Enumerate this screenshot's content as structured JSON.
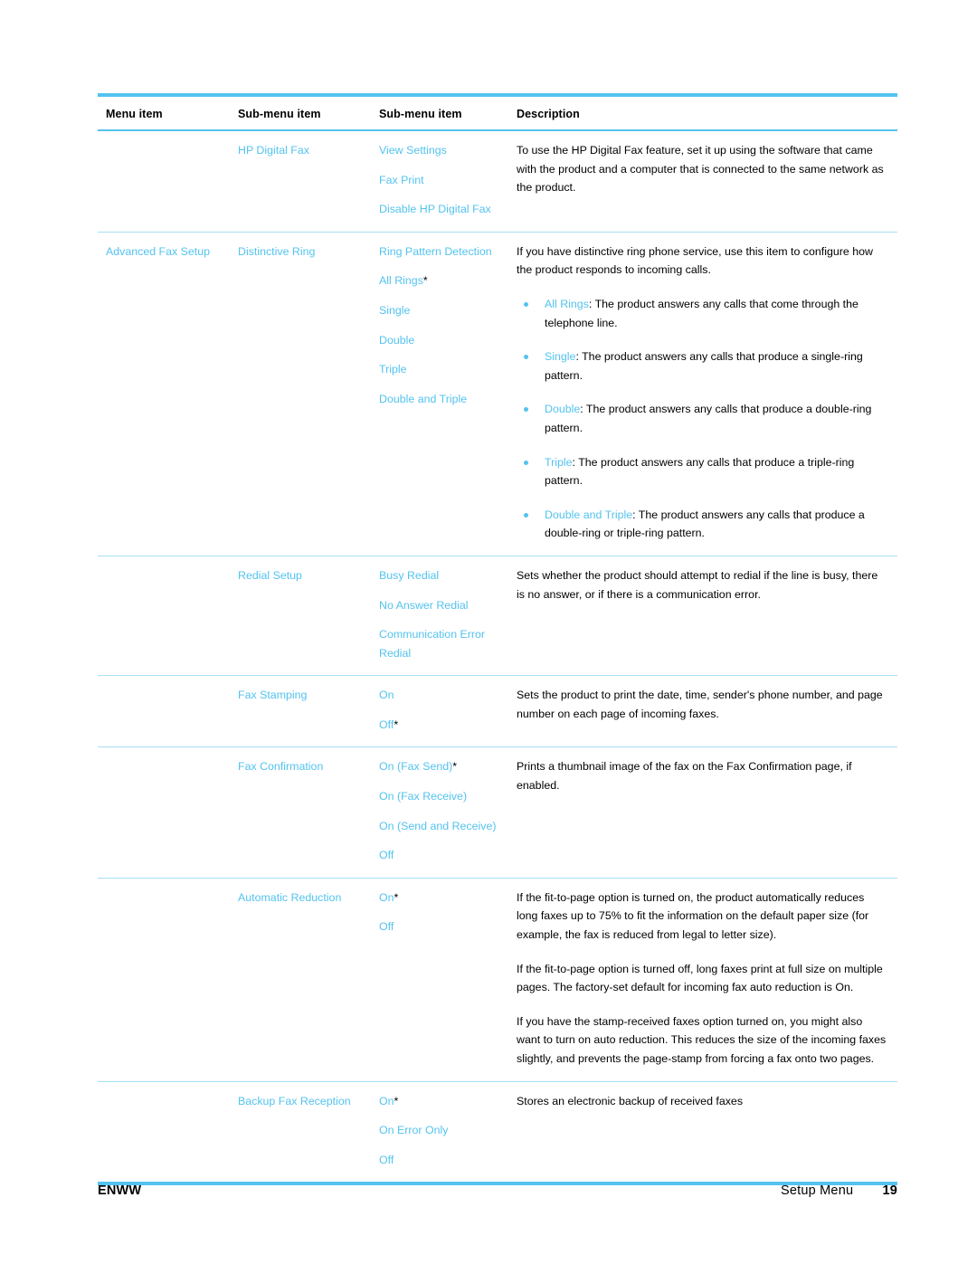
{
  "document": {
    "table": {
      "headers": [
        "Menu item",
        "Sub-menu item",
        "Sub-menu item",
        "Description"
      ],
      "rows": [
        {
          "menu_item": "",
          "sub_menu_1": "HP Digital Fax",
          "sub_menu_2": [
            "View Settings",
            "Fax Print",
            "Disable HP Digital Fax"
          ],
          "sub_menu_2_default": "",
          "description_paragraphs": [
            "To use the HP Digital Fax feature, set it up using the software that came with the product and a computer that is connected to the same network as the product."
          ],
          "bullets": []
        },
        {
          "menu_item": "Advanced Fax Setup",
          "sub_menu_1": "Distinctive Ring",
          "sub_menu_2": [
            "Ring Pattern Detection",
            "All Rings",
            "Single",
            "Double",
            "Triple",
            "Double and Triple"
          ],
          "sub_menu_2_default": "All Rings",
          "description_paragraphs": [
            "If you have distinctive ring phone service, use this item to configure how the product responds to incoming calls."
          ],
          "bullets": [
            {
              "term": "All Rings",
              "text": ": The product answers any calls that come through the telephone line."
            },
            {
              "term": "Single",
              "text": ": The product answers any calls that produce a single-ring pattern."
            },
            {
              "term": "Double",
              "text": ": The product answers any calls that produce a double-ring pattern."
            },
            {
              "term": "Triple",
              "text": ": The product answers any calls that produce a triple-ring pattern."
            },
            {
              "term": "Double and Triple",
              "text": ": The product answers any calls that produce a double-ring or triple-ring pattern."
            }
          ]
        },
        {
          "menu_item": "",
          "sub_menu_1": "Redial Setup",
          "sub_menu_2": [
            "Busy Redial",
            "No Answer Redial",
            "Communication Error Redial"
          ],
          "sub_menu_2_default": "",
          "description_paragraphs": [
            "Sets whether the product should attempt to redial if the line is busy, there is no answer, or if there is a communication error."
          ],
          "bullets": []
        },
        {
          "menu_item": "",
          "sub_menu_1": "Fax Stamping",
          "sub_menu_2": [
            "On",
            "Off"
          ],
          "sub_menu_2_default": "Off",
          "description_paragraphs": [
            "Sets the product to print the date, time, sender's phone number, and page number on each page of incoming faxes."
          ],
          "bullets": []
        },
        {
          "menu_item": "",
          "sub_menu_1": "Fax Confirmation",
          "sub_menu_2": [
            "On (Fax Send)",
            "On (Fax Receive)",
            "On (Send and Receive)",
            "Off"
          ],
          "sub_menu_2_default": "On (Fax Send)",
          "description_paragraphs": [
            "Prints a thumbnail image of the fax on the Fax Confirmation page, if enabled."
          ],
          "bullets": []
        },
        {
          "menu_item": "",
          "sub_menu_1": "Automatic Reduction",
          "sub_menu_2": [
            "On",
            "Off"
          ],
          "sub_menu_2_default": "On",
          "description_paragraphs": [
            "If the fit-to-page option is turned on, the product automatically reduces long faxes up to 75% to fit the information on the default paper size (for example, the fax is reduced from legal to letter size).",
            "If the fit-to-page option is turned off, long faxes print at full size on multiple pages. The factory-set default for incoming fax auto reduction is On.",
            "If you have the stamp-received faxes option turned on, you might also want to turn on auto reduction. This reduces the size of the incoming faxes slightly, and prevents the page-stamp from forcing a fax onto two pages."
          ],
          "bullets": []
        },
        {
          "menu_item": "",
          "sub_menu_1": "Backup Fax Reception",
          "sub_menu_2": [
            "On",
            "On Error Only",
            "Off"
          ],
          "sub_menu_2_default": "On",
          "description_paragraphs": [
            "Stores an electronic backup of received faxes"
          ],
          "bullets": []
        }
      ]
    },
    "footer": {
      "left": "ENWW",
      "section": "Setup Menu",
      "page_number": "19"
    },
    "colors": {
      "accent_blue": "#53c3ef",
      "rule_blue": "#a8dff5",
      "text_black": "#000000"
    },
    "default_marker": "*"
  }
}
